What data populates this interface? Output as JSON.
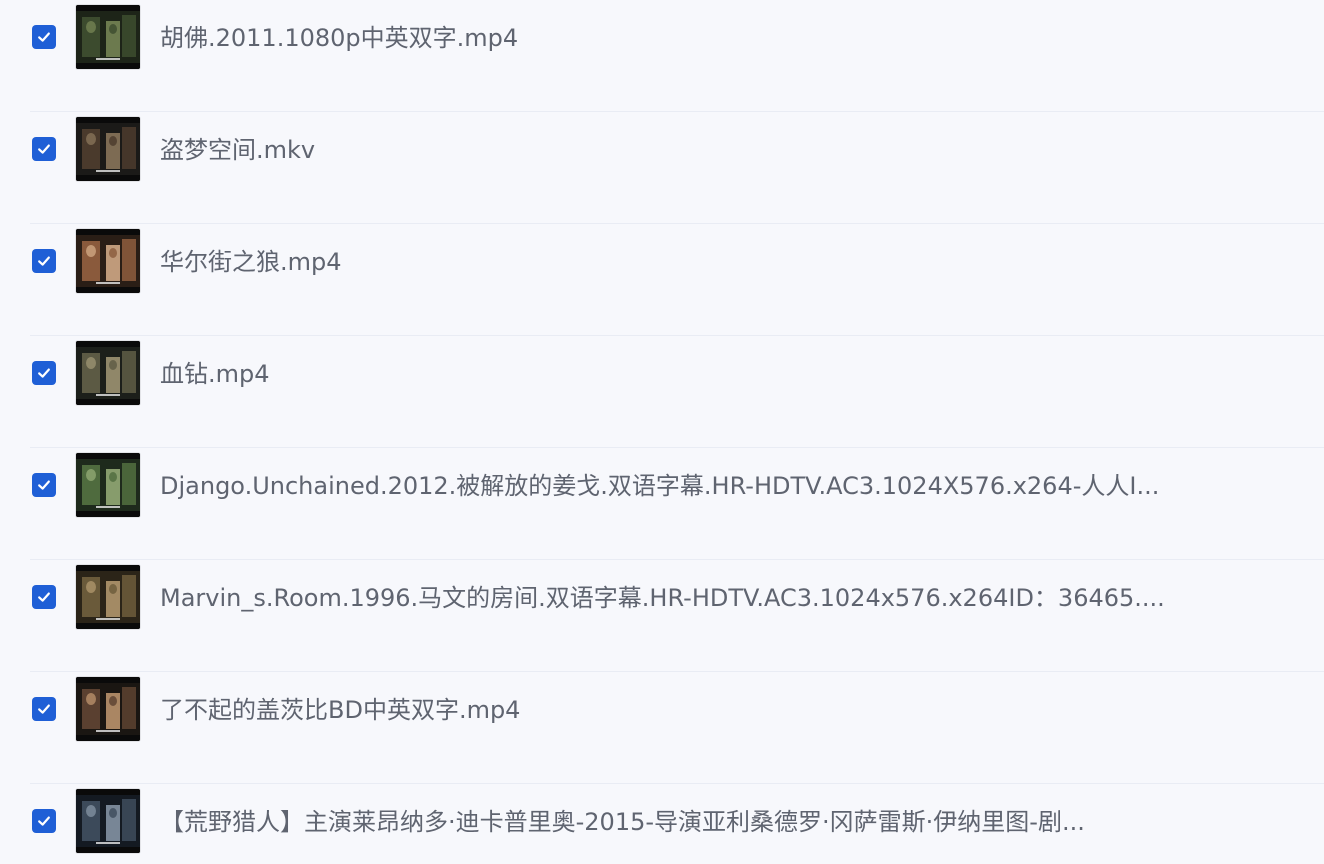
{
  "files": [
    {
      "name": "胡佛.2011.1080p中英双字.mp4",
      "checked": true,
      "thumbnail": "video-thumbnail",
      "palette": [
        "#1d2418",
        "#3c4b2e",
        "#7a8a58"
      ]
    },
    {
      "name": "盗梦空间.mkv",
      "checked": true,
      "thumbnail": "video-thumbnail",
      "palette": [
        "#1b1a18",
        "#4a3a2c",
        "#8e7a5e"
      ]
    },
    {
      "name": "华尔街之狼.mp4",
      "checked": true,
      "thumbnail": "video-thumbnail",
      "palette": [
        "#2a1e16",
        "#8a5a3c",
        "#d9b08c"
      ]
    },
    {
      "name": "血钻.mp4",
      "checked": true,
      "thumbnail": "video-thumbnail",
      "palette": [
        "#1c1f1a",
        "#5c5a44",
        "#a49a78"
      ]
    },
    {
      "name": "Django.Unchained.2012.被解放的姜戈.双语字幕.HR-HDTV.AC3.1024X576.x264-人人I...",
      "checked": true,
      "thumbnail": "video-thumbnail",
      "palette": [
        "#1e2a1c",
        "#4f6b3e",
        "#9ab07a"
      ]
    },
    {
      "name": "Marvin_s.Room.1996.马文的房间.双语字幕.HR-HDTV.AC3.1024x576.x264ID：36465....",
      "checked": true,
      "thumbnail": "video-thumbnail",
      "palette": [
        "#2b2418",
        "#6a5a3a",
        "#b89c72"
      ]
    },
    {
      "name": "了不起的盖茨比BD中英双字.mp4",
      "checked": true,
      "thumbnail": "video-thumbnail",
      "palette": [
        "#1a1612",
        "#5a4030",
        "#c49a72"
      ]
    },
    {
      "name": "【荒野猎人】主演莱昂纳多·迪卡普里奥-2015-导演亚利桑德罗·冈萨雷斯·伊纳里图-剧...",
      "checked": true,
      "thumbnail": "video-thumbnail",
      "palette": [
        "#141a22",
        "#3c4a5a",
        "#8a9aaa"
      ]
    }
  ],
  "colors": {
    "checkbox": "#1f5fd6",
    "text": "#5f6470",
    "background": "#f7f8fc",
    "divider": "#e9ecf4"
  }
}
